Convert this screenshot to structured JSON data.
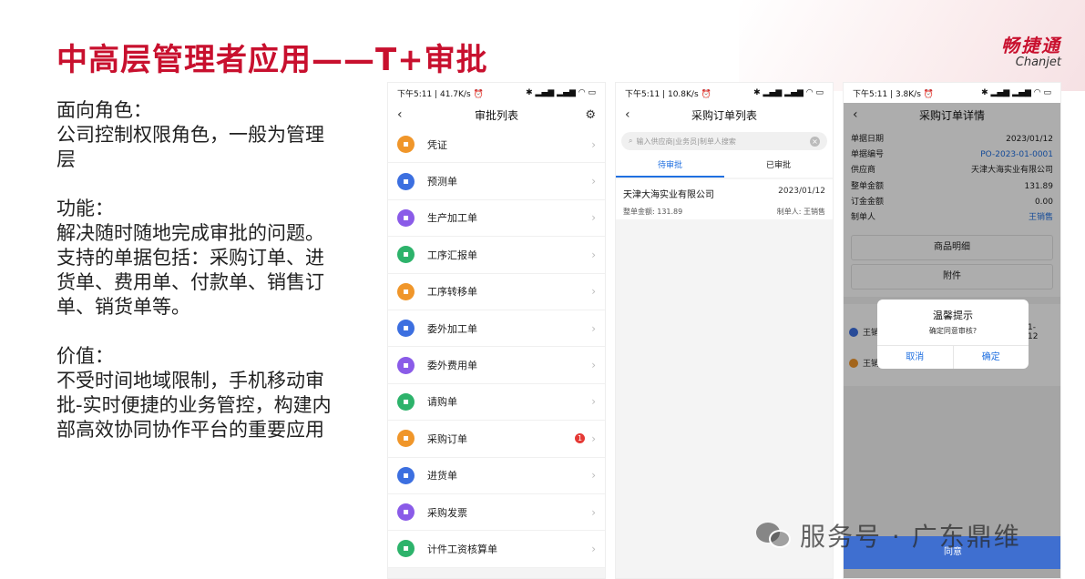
{
  "slide": {
    "title": "中高层管理者应用——T+审批",
    "logo_cn": "畅捷通",
    "logo_en": "Chanjet",
    "paragraphs": [
      "面向角色：\n公司控制权限角色，一般为管理层",
      "功能：\n解决随时随地完成审批的问题。支持的单据包括：采购订单、进货单、费用单、付款单、销售订单、销货单等。",
      "价值：\n不受时间地域限制，手机移动审批-实时便捷的业务管控，构建内部高效协同协作平台的重要应用"
    ],
    "watermark": "服务号 · 广东鼎维"
  },
  "phone1": {
    "status_left": "下午5:11 | 41.7K/s ⏰",
    "title": "审批列表",
    "items": [
      {
        "label": "凭证",
        "icon": "voucher-icon",
        "color": "#f0962a"
      },
      {
        "label": "预测单",
        "icon": "shield-icon",
        "color": "#3c6fe0"
      },
      {
        "label": "生产加工单",
        "icon": "production-icon",
        "color": "#8a5be8"
      },
      {
        "label": "工序汇报单",
        "icon": "report-icon",
        "color": "#2db36b"
      },
      {
        "label": "工序转移单",
        "icon": "transfer-icon",
        "color": "#f0962a"
      },
      {
        "label": "委外加工单",
        "icon": "outsource-icon",
        "color": "#3c6fe0"
      },
      {
        "label": "委外费用单",
        "icon": "fee-icon",
        "color": "#8a5be8"
      },
      {
        "label": "请购单",
        "icon": "requisition-icon",
        "color": "#2db36b"
      },
      {
        "label": "采购订单",
        "icon": "purchase-order-icon",
        "color": "#f0962a",
        "badge": "1"
      },
      {
        "label": "进货单",
        "icon": "receipt-icon",
        "color": "#3c6fe0"
      },
      {
        "label": "采购发票",
        "icon": "invoice-icon",
        "color": "#8a5be8"
      },
      {
        "label": "计件工资核算单",
        "icon": "wage-icon",
        "color": "#2db36b"
      }
    ]
  },
  "phone2": {
    "status_left": "下午5:11 | 10.8K/s ⏰",
    "title": "采购订单列表",
    "search_placeholder": "输入供应商|业务员|制单人搜索",
    "tab_pending": "待审批",
    "tab_done": "已审批",
    "card": {
      "supplier": "天津大海实业有限公司",
      "date": "2023/01/12",
      "amount": "整单金额: 131.89",
      "creator": "制单人: 王销售"
    }
  },
  "phone3": {
    "status_left": "下午5:11 | 3.8K/s ⏰",
    "title": "采购订单详情",
    "fields": [
      {
        "k": "单据日期",
        "v": "2023/01/12",
        "blue": false
      },
      {
        "k": "单据编号",
        "v": "PO-2023-01-0001",
        "blue": true
      },
      {
        "k": "供应商",
        "v": "天津大海实业有限公司",
        "blue": false
      },
      {
        "k": "整单金额",
        "v": "131.89",
        "blue": false
      },
      {
        "k": "订金金额",
        "v": "0.00",
        "blue": false
      },
      {
        "k": "制单人",
        "v": "王销售",
        "blue": true
      }
    ],
    "btn_goods": "商品明细",
    "btn_attach": "附件",
    "flow1": "王销",
    "flow1_tail": "1-12",
    "flow2": "王销",
    "agree": "同意",
    "dialog": {
      "title": "温馨提示",
      "message": "确定同意审核?",
      "cancel": "取消",
      "confirm": "确定"
    }
  }
}
